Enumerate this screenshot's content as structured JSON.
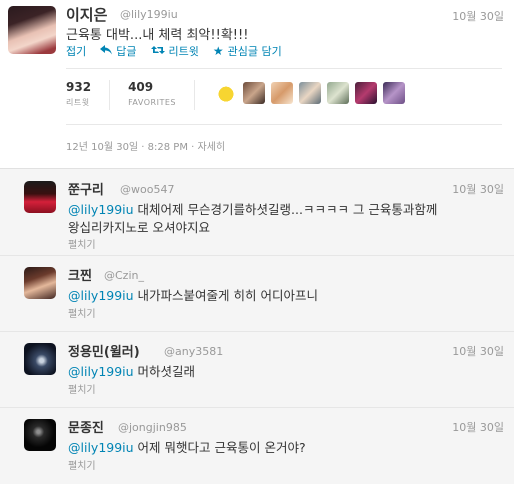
{
  "main_tweet": {
    "name": "이지은",
    "handle": "@lily199iu",
    "date": "10월 30일",
    "text": "근육통 대박...내 체력 최악!!확!!!",
    "actions": {
      "collapse": "접기",
      "reply": "답글",
      "retweet": "리트윗",
      "favorite": "관심글 담기"
    },
    "stats": {
      "retweets_count": "932",
      "retweets_label": "리트윗",
      "favorites_count": "409",
      "favorites_label": "FAVORITES"
    },
    "timestamp": "12년 10월 30일 · 8:28 PM",
    "detail_link": "자세히"
  },
  "replies": [
    {
      "name": "쭌구리",
      "handle": "@woo547",
      "date": "10월 30일",
      "mention": "@lily199iu",
      "line1": " 대체어제 무슨경기를하셧길랭...ㅋㅋㅋㅋ 그 근육통과함께",
      "line2": "왕십리카지노로 오셔야지요",
      "expand": "펼치기"
    },
    {
      "name": "크찐",
      "handle": "@Czin_",
      "date": "",
      "mention": "@lily199iu",
      "line1": " 내가파스붙여줄게 히히 어디아프니",
      "line2": "",
      "expand": "펼치기"
    },
    {
      "name": "정용민(윌러)",
      "handle": "@any3581",
      "date": "10월 30일",
      "mention": "@lily199iu",
      "line1": " 머하셧길래",
      "line2": "",
      "expand": "펼치기"
    },
    {
      "name": "문종진",
      "handle": "@jongjin985",
      "date": "10월 30일",
      "mention": "@lily199iu",
      "line1": " 어제 뭐햇다고 근육통이 온거야?",
      "line2": "",
      "expand": "펼치기"
    }
  ],
  "icons": {
    "reply": "reply-arrow-icon",
    "retweet": "retweet-icon",
    "favorite": "star-icon"
  },
  "colors": {
    "link": "#0084b4",
    "muted": "#999999",
    "text": "#333333",
    "reply_bg": "#f5f5f5"
  }
}
